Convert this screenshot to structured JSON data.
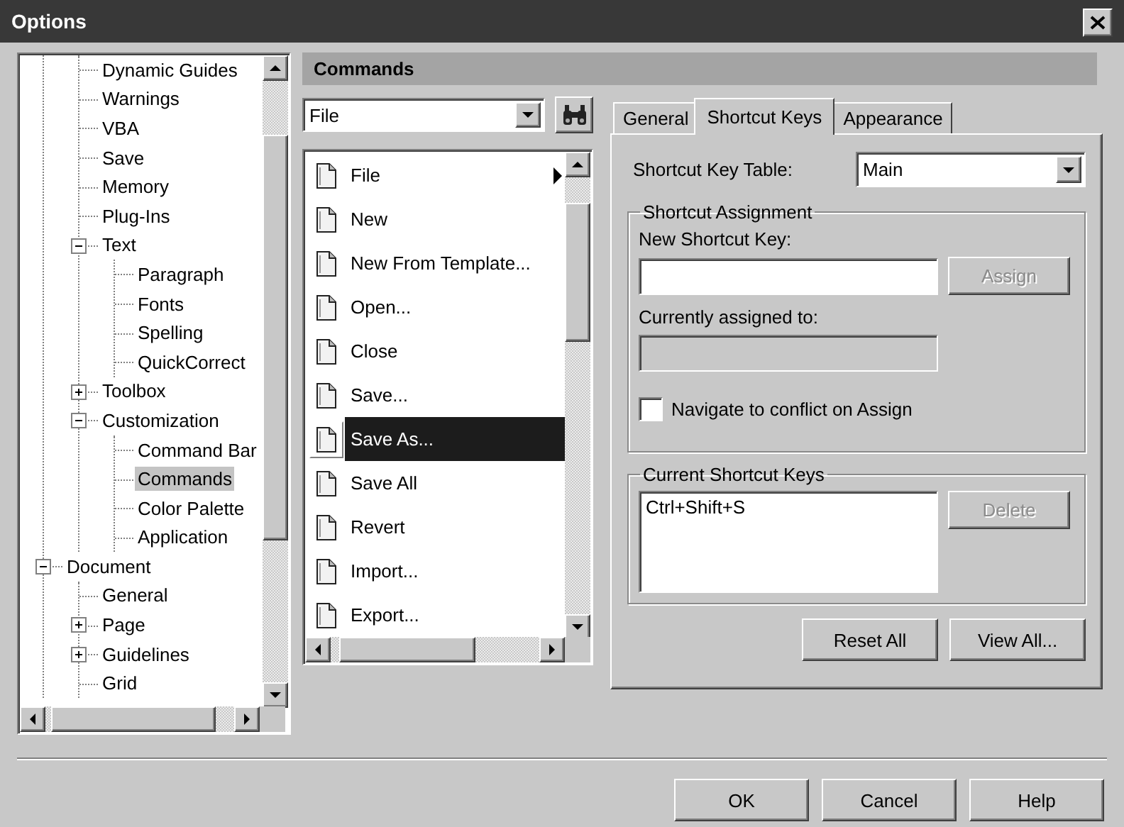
{
  "window": {
    "title": "Options"
  },
  "tree": {
    "items": [
      {
        "children": [
          {
            "label": "Dynamic Guides",
            "selected": false
          },
          {
            "label": "Warnings",
            "selected": false
          },
          {
            "label": "VBA",
            "selected": false
          },
          {
            "label": "Save",
            "selected": false
          },
          {
            "label": "Memory",
            "selected": false
          },
          {
            "label": "Plug-Ins",
            "selected": false
          },
          {
            "label": "Text",
            "selected": false,
            "expanded": true,
            "children": [
              {
                "label": "Paragraph",
                "selected": false
              },
              {
                "label": "Fonts",
                "selected": false
              },
              {
                "label": "Spelling",
                "selected": false
              },
              {
                "label": "QuickCorrect",
                "selected": false
              }
            ]
          },
          {
            "label": "Toolbox",
            "selected": false,
            "expanded": false
          },
          {
            "label": "Customization",
            "selected": false,
            "expanded": true,
            "children": [
              {
                "label": "Command Bar",
                "selected": false
              },
              {
                "label": "Commands",
                "selected": true
              },
              {
                "label": "Color Palette",
                "selected": false
              },
              {
                "label": "Application",
                "selected": false
              }
            ]
          }
        ]
      },
      {
        "label": "Document",
        "selected": false,
        "expanded": true,
        "children": [
          {
            "label": "General",
            "selected": false
          },
          {
            "label": "Page",
            "selected": false,
            "expanded": false
          },
          {
            "label": "Guidelines",
            "selected": false,
            "expanded": false
          },
          {
            "label": "Grid",
            "selected": false
          }
        ]
      }
    ]
  },
  "commands_panel": {
    "title": "Commands",
    "category": {
      "value": "File"
    },
    "commands": [
      {
        "label": "File",
        "selected": false,
        "submenu": true
      },
      {
        "label": "New",
        "selected": false,
        "submenu": false
      },
      {
        "label": "New From Template...",
        "selected": false,
        "submenu": false
      },
      {
        "label": "Open...",
        "selected": false,
        "submenu": false
      },
      {
        "label": "Close",
        "selected": false,
        "submenu": false
      },
      {
        "label": "Save...",
        "selected": false,
        "submenu": false
      },
      {
        "label": "Save As...",
        "selected": true,
        "submenu": false
      },
      {
        "label": "Save All",
        "selected": false,
        "submenu": false
      },
      {
        "label": "Revert",
        "selected": false,
        "submenu": false
      },
      {
        "label": "Import...",
        "selected": false,
        "submenu": false
      },
      {
        "label": "Export...",
        "selected": false,
        "submenu": false
      }
    ]
  },
  "tabs": [
    {
      "label": "General",
      "selected": false
    },
    {
      "label": "Shortcut Keys",
      "selected": true
    },
    {
      "label": "Appearance",
      "selected": false
    }
  ],
  "shortcut_key_table": {
    "label": "Shortcut Key Table:",
    "value": "Main"
  },
  "assignment": {
    "title": "Shortcut Assignment",
    "new_key_label": "New Shortcut Key:",
    "assign_button": {
      "label": "Assign",
      "disabled": true
    },
    "assigned_label": "Currently assigned to:",
    "assigned_field": {
      "disabled": true
    },
    "navigate_checkbox": {
      "label": "Navigate to conflict on Assign",
      "checked": false
    }
  },
  "current_keys": {
    "title": "Current Shortcut Keys",
    "keys": [
      "Ctrl+Shift+S"
    ],
    "delete_button": {
      "label": "Delete",
      "disabled": true
    }
  },
  "panel_buttons": [
    {
      "label": "Reset All",
      "disabled": false
    },
    {
      "label": "View All...",
      "disabled": false
    }
  ],
  "dialog_buttons": [
    {
      "label": "OK"
    },
    {
      "label": "Cancel"
    },
    {
      "label": "Help"
    }
  ]
}
